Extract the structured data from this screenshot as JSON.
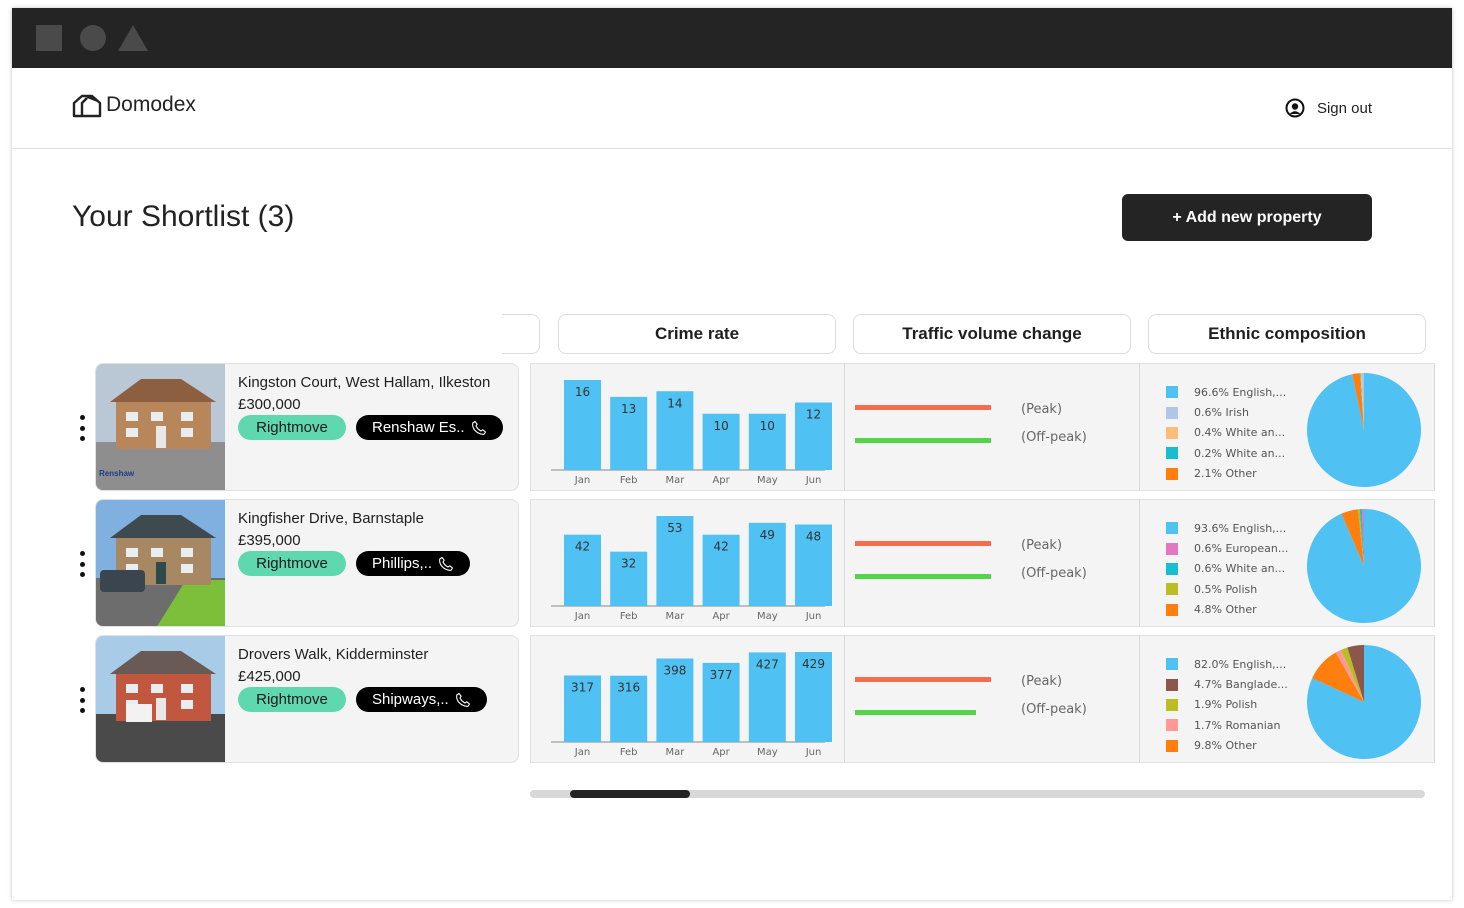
{
  "window": {
    "controls": [
      "square",
      "circle",
      "triangle"
    ]
  },
  "header": {
    "brand": "Domodex",
    "logo_icon": "house-icon",
    "sign_out_label": "Sign out",
    "sign_out_icon": "user-circle-icon"
  },
  "page": {
    "title": "Your Shortlist (3)",
    "add_button_label": "+ Add new property"
  },
  "columns": [
    "Crime rate",
    "Traffic volume change",
    "Ethnic composition"
  ],
  "colors": {
    "bar": "#4fc1f2",
    "peak_line": "#f46e4e",
    "offpeak_line": "#55d44a",
    "rightmove_pill": "#5fd8b0",
    "agent_pill": "#000000",
    "add_button": "#242424"
  },
  "properties": [
    {
      "address": "Kingston Court, West Hallam, Ilkeston",
      "price": "£300,000",
      "source_label": "Rightmove",
      "agent_label": "Renshaw Es..",
      "photo_watermark": "Renshaw estates",
      "traffic": {
        "peak_label": "(Peak)",
        "offpeak_label": "(Off-peak)",
        "peak_rel": 1.0,
        "offpeak_rel": 1.0
      },
      "ethnic": [
        {
          "label": "96.6% English,...",
          "pct": 96.6,
          "color": "#4fc1f2"
        },
        {
          "label": "0.6% Irish",
          "pct": 0.6,
          "color": "#aec7e8"
        },
        {
          "label": "0.4% White an...",
          "pct": 0.4,
          "color": "#ffbb78"
        },
        {
          "label": "0.2% White an...",
          "pct": 0.2,
          "color": "#17becf"
        },
        {
          "label": "2.1% Other",
          "pct": 2.1,
          "color": "#ff7f0e"
        }
      ]
    },
    {
      "address": "Kingfisher Drive, Barnstaple",
      "price": "£395,000",
      "source_label": "Rightmove",
      "agent_label": "Phillips,..",
      "traffic": {
        "peak_label": "(Peak)",
        "offpeak_label": "(Off-peak)",
        "peak_rel": 1.0,
        "offpeak_rel": 1.0
      },
      "ethnic": [
        {
          "label": "93.6% English,...",
          "pct": 93.6,
          "color": "#4fc1f2"
        },
        {
          "label": "0.6% European...",
          "pct": 0.6,
          "color": "#e377c2"
        },
        {
          "label": "0.6% White an...",
          "pct": 0.6,
          "color": "#17becf"
        },
        {
          "label": "0.5% Polish",
          "pct": 0.5,
          "color": "#bcbd22"
        },
        {
          "label": "4.8% Other",
          "pct": 4.8,
          "color": "#ff7f0e"
        }
      ]
    },
    {
      "address": "Drovers Walk, Kidderminster",
      "price": "£425,000",
      "source_label": "Rightmove",
      "agent_label": "Shipways,..",
      "traffic": {
        "peak_label": "(Peak)",
        "offpeak_label": "(Off-peak)",
        "peak_rel": 1.0,
        "offpeak_rel": 0.89
      },
      "ethnic": [
        {
          "label": "82.0% English,...",
          "pct": 82.0,
          "color": "#4fc1f2"
        },
        {
          "label": "4.7% Banglade...",
          "pct": 4.7,
          "color": "#8c564b"
        },
        {
          "label": "1.9% Polish",
          "pct": 1.9,
          "color": "#bcbd22"
        },
        {
          "label": "1.7% Romanian",
          "pct": 1.7,
          "color": "#ff9896"
        },
        {
          "label": "9.8% Other",
          "pct": 9.8,
          "color": "#ff7f0e"
        }
      ]
    }
  ],
  "scrollbar": {
    "position_fraction": 0.045,
    "visible_fraction": 0.134
  },
  "chart_data": [
    {
      "type": "bar",
      "title": "Crime rate — Kingston Court, West Hallam, Ilkeston",
      "categories": [
        "Jan",
        "Feb",
        "Mar",
        "Apr",
        "May",
        "Jun"
      ],
      "values": [
        16,
        13,
        14,
        10,
        10,
        12
      ],
      "xlabel": "",
      "ylabel": "",
      "grid": false
    },
    {
      "type": "bar",
      "title": "Crime rate — Kingfisher Drive, Barnstaple",
      "categories": [
        "Jan",
        "Feb",
        "Mar",
        "Apr",
        "May",
        "Jun"
      ],
      "values": [
        42,
        32,
        53,
        42,
        49,
        48
      ],
      "xlabel": "",
      "ylabel": "",
      "grid": false
    },
    {
      "type": "bar",
      "title": "Crime rate — Drovers Walk, Kidderminster",
      "categories": [
        "Jan",
        "Feb",
        "Mar",
        "Apr",
        "May",
        "Jun"
      ],
      "values": [
        317,
        316,
        398,
        377,
        427,
        429
      ],
      "xlabel": "",
      "ylabel": "",
      "grid": false
    },
    {
      "type": "pie",
      "title": "Ethnic composition — Kingston Court",
      "labels": [
        "English",
        "Irish",
        "White and ...",
        "White and ...",
        "Other"
      ],
      "values": [
        96.6,
        0.6,
        0.4,
        0.2,
        2.1
      ],
      "legend": "left"
    },
    {
      "type": "pie",
      "title": "Ethnic composition — Kingfisher Drive",
      "labels": [
        "English",
        "European",
        "White and ...",
        "Polish",
        "Other"
      ],
      "values": [
        93.6,
        0.6,
        0.6,
        0.5,
        4.8
      ],
      "legend": "left"
    },
    {
      "type": "pie",
      "title": "Ethnic composition — Drovers Walk",
      "labels": [
        "English",
        "Bangladeshi",
        "Polish",
        "Romanian",
        "Other"
      ],
      "values": [
        82.0,
        4.7,
        1.9,
        1.7,
        9.8
      ],
      "legend": "left"
    }
  ]
}
